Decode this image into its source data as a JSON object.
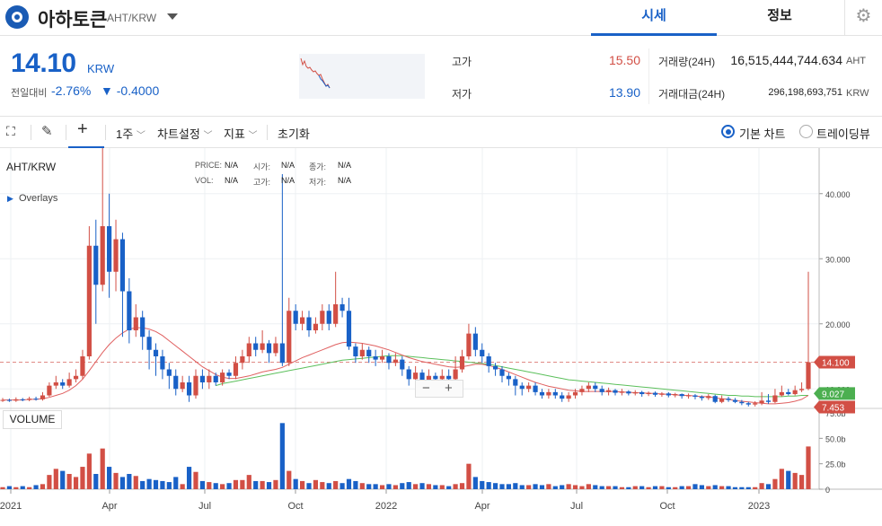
{
  "header": {
    "coin_name": "아하토큰",
    "pair": "AHT/KRW",
    "tab_quote": "시세",
    "tab_info": "정보"
  },
  "price": {
    "current": "14.10",
    "unit": "KRW",
    "change_label": "전일대비",
    "change_rate": "-2.76%",
    "change_amount": "▼ -0.4000"
  },
  "stats": {
    "high_label": "고가",
    "high_value": "15.50",
    "low_label": "저가",
    "low_value": "13.90",
    "volume_label": "거래량(24H)",
    "volume_value": "16,515,444,744.634",
    "volume_unit": "AHT",
    "amount_label": "거래대금(24H)",
    "amount_value": "296,198,693,751",
    "amount_unit": "KRW"
  },
  "toolbar": {
    "interval": "1주",
    "chart_settings": "차트설정",
    "indicators": "지표",
    "reset": "초기화",
    "basic_chart": "기본 차트",
    "trading_view": "트레이딩뷰"
  },
  "colors": {
    "up": "#d24f45",
    "down": "#1961c7",
    "ma_short": "#e06060",
    "ma_long": "#5cc05c",
    "accent": "#1961c7"
  },
  "chart_data": {
    "type": "candlestick",
    "title": "AHT/KRW",
    "overlays_label": "Overlays",
    "info": {
      "price_label": "PRICE:",
      "price": "N/A",
      "time_label": "시가:",
      "time": "N/A",
      "close_label": "종가:",
      "close": "N/A",
      "vol_label": "VOL:",
      "vol": "N/A",
      "high_label": "고가:",
      "high": "N/A",
      "low_label": "저가:",
      "low": "N/A"
    },
    "x_ticks": [
      "2021",
      "Apr",
      "Jul",
      "Oct",
      "2022",
      "Apr",
      "Jul",
      "Oct",
      "2023"
    ],
    "y_ticks": [
      "40.000",
      "30.000",
      "20.000",
      "10.000"
    ],
    "ylim": [
      7,
      47
    ],
    "volume_label": "VOLUME",
    "volume_ticks": [
      "75.0b",
      "50.0b",
      "25.0b",
      "0"
    ],
    "volume_ylim": [
      0,
      75
    ],
    "price_tags": {
      "current": "14.100",
      "ma_long": "9.027",
      "ma_short": "7.453"
    },
    "candles": [
      [
        8.2,
        8.3,
        8.6,
        8.0,
        2
      ],
      [
        8.3,
        8.2,
        8.5,
        8.0,
        3
      ],
      [
        8.2,
        8.4,
        8.7,
        8.0,
        2
      ],
      [
        8.4,
        8.3,
        8.6,
        8.1,
        3
      ],
      [
        8.3,
        8.5,
        8.8,
        8.1,
        2
      ],
      [
        8.5,
        8.4,
        8.8,
        8.2,
        4
      ],
      [
        8.4,
        9.0,
        9.5,
        8.2,
        5
      ],
      [
        9.0,
        10.5,
        11.0,
        8.8,
        14
      ],
      [
        10.5,
        11.0,
        12.0,
        10.0,
        20
      ],
      [
        11.0,
        10.5,
        11.5,
        10.0,
        18
      ],
      [
        10.5,
        11.5,
        12.5,
        10.2,
        15
      ],
      [
        11.5,
        12.0,
        13.0,
        11.0,
        12
      ],
      [
        12.0,
        15.0,
        16.0,
        11.5,
        22
      ],
      [
        15.0,
        32.0,
        35.0,
        14.5,
        35
      ],
      [
        32.0,
        26.0,
        36.0,
        20.0,
        15
      ],
      [
        26.0,
        35.0,
        47.0,
        25.0,
        40
      ],
      [
        35.0,
        28.0,
        40.0,
        24.0,
        22
      ],
      [
        28.0,
        33.0,
        36.0,
        25.0,
        16
      ],
      [
        33.0,
        25.0,
        34.0,
        18.0,
        12
      ],
      [
        25.0,
        19.0,
        27.0,
        17.0,
        15
      ],
      [
        19.0,
        21.0,
        23.0,
        18.0,
        13
      ],
      [
        21.0,
        18.0,
        22.0,
        16.0,
        8
      ],
      [
        18.0,
        16.0,
        19.0,
        13.0,
        10
      ],
      [
        16.0,
        15.0,
        17.0,
        12.0,
        9
      ],
      [
        15.0,
        13.0,
        16.0,
        11.5,
        8
      ],
      [
        13.0,
        12.0,
        14.0,
        10.0,
        7
      ],
      [
        12.0,
        10.0,
        13.0,
        9.0,
        12
      ],
      [
        10.0,
        11.0,
        12.0,
        9.5,
        5
      ],
      [
        11.0,
        9.0,
        12.0,
        8.0,
        22
      ],
      [
        9.0,
        12.0,
        13.0,
        8.5,
        17
      ],
      [
        12.0,
        11.0,
        13.0,
        10.0,
        8
      ],
      [
        11.0,
        12.0,
        13.0,
        10.0,
        7
      ],
      [
        12.0,
        11.0,
        12.5,
        10.5,
        6
      ],
      [
        11.0,
        12.5,
        13.0,
        10.5,
        5
      ],
      [
        12.5,
        12.0,
        13.0,
        11.5,
        6
      ],
      [
        12.0,
        14.0,
        15.0,
        11.5,
        9
      ],
      [
        14.0,
        15.0,
        16.0,
        13.0,
        9
      ],
      [
        15.0,
        17.0,
        18.0,
        14.0,
        14
      ],
      [
        17.0,
        16.0,
        18.0,
        15.0,
        8
      ],
      [
        16.0,
        17.0,
        19.0,
        15.5,
        8
      ],
      [
        17.0,
        15.5,
        17.5,
        14.0,
        7
      ],
      [
        15.5,
        17.0,
        18.0,
        15.0,
        9
      ],
      [
        17.0,
        14.0,
        43.0,
        13.5,
        65
      ],
      [
        14.0,
        22.0,
        24.0,
        13.5,
        18
      ],
      [
        22.0,
        20.0,
        23.0,
        19.0,
        10
      ],
      [
        20.0,
        21.0,
        22.0,
        19.0,
        8
      ],
      [
        21.0,
        19.0,
        22.0,
        18.0,
        6
      ],
      [
        19.0,
        20.0,
        21.0,
        18.5,
        9
      ],
      [
        20.0,
        22.0,
        23.0,
        19.0,
        7
      ],
      [
        22.0,
        20.0,
        23.0,
        19.0,
        6
      ],
      [
        20.0,
        23.0,
        28.0,
        19.5,
        8
      ],
      [
        23.0,
        22.0,
        24.0,
        21.0,
        6
      ],
      [
        22.0,
        16.5,
        24.0,
        16.0,
        10
      ],
      [
        16.5,
        15.0,
        17.0,
        14.0,
        8
      ],
      [
        15.0,
        16.0,
        17.0,
        14.5,
        6
      ],
      [
        16.0,
        15.0,
        16.5,
        14.0,
        5
      ],
      [
        15.0,
        14.5,
        16.0,
        13.5,
        5
      ],
      [
        14.5,
        15.0,
        16.0,
        14.0,
        4
      ],
      [
        15.0,
        14.0,
        15.5,
        13.0,
        5
      ],
      [
        14.0,
        14.5,
        15.5,
        13.5,
        4
      ],
      [
        14.5,
        13.0,
        15.0,
        12.0,
        6
      ],
      [
        13.0,
        11.5,
        13.5,
        10.5,
        7
      ],
      [
        11.5,
        12.5,
        13.5,
        11.0,
        5
      ],
      [
        12.5,
        11.0,
        13.0,
        10.0,
        6
      ],
      [
        11.0,
        12.0,
        13.0,
        10.5,
        5
      ],
      [
        12.0,
        11.5,
        12.5,
        11.0,
        4
      ],
      [
        11.5,
        12.0,
        13.0,
        11.0,
        4
      ],
      [
        12.0,
        11.5,
        13.0,
        11.0,
        3
      ],
      [
        11.5,
        13.0,
        15.0,
        11.0,
        5
      ],
      [
        13.0,
        15.0,
        16.0,
        12.5,
        6
      ],
      [
        15.0,
        18.5,
        20.0,
        14.5,
        25
      ],
      [
        18.5,
        16.0,
        19.5,
        15.0,
        12
      ],
      [
        16.0,
        15.0,
        17.0,
        14.0,
        8
      ],
      [
        15.0,
        13.5,
        15.5,
        12.5,
        7
      ],
      [
        13.5,
        13.0,
        14.0,
        12.0,
        6
      ],
      [
        13.0,
        12.0,
        13.5,
        11.0,
        5
      ],
      [
        12.0,
        11.5,
        12.5,
        10.5,
        5
      ],
      [
        11.5,
        10.5,
        12.0,
        9.0,
        6
      ],
      [
        10.5,
        10.0,
        11.0,
        9.0,
        4
      ],
      [
        10.0,
        10.5,
        11.0,
        9.5,
        4
      ],
      [
        10.5,
        9.5,
        11.0,
        9.0,
        5
      ],
      [
        9.5,
        9.0,
        10.0,
        8.5,
        4
      ],
      [
        9.0,
        9.5,
        10.0,
        8.5,
        5
      ],
      [
        9.5,
        9.0,
        10.0,
        8.5,
        3
      ],
      [
        9.0,
        8.5,
        9.5,
        8.0,
        4
      ],
      [
        8.5,
        9.0,
        9.5,
        8.0,
        5
      ],
      [
        9.0,
        9.5,
        10.0,
        8.5,
        4
      ],
      [
        9.5,
        10.0,
        10.5,
        9.0,
        3
      ],
      [
        10.0,
        10.5,
        11.0,
        9.5,
        5
      ],
      [
        10.5,
        10.0,
        11.0,
        9.5,
        4
      ],
      [
        10.0,
        9.5,
        10.5,
        9.0,
        3
      ],
      [
        9.5,
        9.8,
        10.2,
        9.0,
        3
      ],
      [
        9.8,
        9.4,
        10.0,
        9.0,
        3
      ],
      [
        9.4,
        9.6,
        10.0,
        9.0,
        2
      ],
      [
        9.6,
        9.3,
        9.8,
        9.0,
        2
      ],
      [
        9.3,
        9.5,
        9.8,
        9.0,
        3
      ],
      [
        9.5,
        9.2,
        9.7,
        8.8,
        3
      ],
      [
        9.2,
        9.4,
        9.6,
        8.9,
        2
      ],
      [
        9.4,
        9.1,
        9.6,
        8.8,
        3
      ],
      [
        9.1,
        9.3,
        9.5,
        8.8,
        3
      ],
      [
        9.3,
        9.0,
        9.5,
        8.7,
        2
      ],
      [
        9.0,
        9.2,
        9.4,
        8.7,
        2
      ],
      [
        9.2,
        8.9,
        9.3,
        8.5,
        3
      ],
      [
        8.9,
        9.0,
        9.3,
        8.5,
        3
      ],
      [
        9.0,
        8.8,
        9.2,
        8.4,
        5
      ],
      [
        8.8,
        8.6,
        9.0,
        8.2,
        4
      ],
      [
        8.6,
        8.9,
        9.2,
        8.3,
        3
      ],
      [
        8.9,
        8.0,
        9.1,
        7.8,
        4
      ],
      [
        8.0,
        8.5,
        9.0,
        7.8,
        3
      ],
      [
        8.5,
        8.3,
        8.8,
        8.0,
        3
      ],
      [
        8.3,
        8.0,
        8.6,
        7.8,
        2
      ],
      [
        8.0,
        7.8,
        8.3,
        7.5,
        2
      ],
      [
        7.8,
        7.6,
        8.0,
        7.3,
        2
      ],
      [
        7.6,
        7.8,
        8.1,
        7.3,
        2
      ],
      [
        7.8,
        8.2,
        9.5,
        7.5,
        6
      ],
      [
        8.2,
        8.0,
        9.2,
        7.7,
        5
      ],
      [
        8.0,
        9.0,
        10.0,
        7.8,
        10
      ],
      [
        9.0,
        9.5,
        10.5,
        8.8,
        20
      ],
      [
        9.5,
        9.2,
        10.0,
        9.0,
        18
      ],
      [
        9.2,
        9.8,
        10.5,
        9.0,
        16
      ],
      [
        9.8,
        10.0,
        11.0,
        9.5,
        14
      ],
      [
        10.0,
        14.1,
        28.0,
        9.8,
        42
      ]
    ],
    "ma_short": [
      8.3,
      8.3,
      8.3,
      8.3,
      8.4,
      8.4,
      8.5,
      8.7,
      9.0,
      9.3,
      9.8,
      10.5,
      11.5,
      12.8,
      14.2,
      15.6,
      16.8,
      17.8,
      18.6,
      19.2,
      19.4,
      19.4,
      19.2,
      18.8,
      18.2,
      17.4,
      16.6,
      15.8,
      15.0,
      14.2,
      13.4,
      12.8,
      12.2,
      11.8,
      11.6,
      11.6,
      11.8,
      12.0,
      12.3,
      12.6,
      12.8,
      13.0,
      13.3,
      13.8,
      14.3,
      14.8,
      15.2,
      15.6,
      16.0,
      16.4,
      16.8,
      17.1,
      17.2,
      17.1,
      17.0,
      16.8,
      16.6,
      16.3,
      16.0,
      15.6,
      15.2,
      14.8,
      14.5,
      14.2,
      14.0,
      13.8,
      13.6,
      13.4,
      13.3,
      13.4,
      13.6,
      13.8,
      13.8,
      13.6,
      13.3,
      13.0,
      12.6,
      12.2,
      11.8,
      11.4,
      11.0,
      10.7,
      10.4,
      10.2,
      10.0,
      9.8,
      9.7,
      9.6,
      9.6,
      9.6,
      9.6,
      9.6,
      9.6,
      9.5,
      9.5,
      9.4,
      9.4,
      9.3,
      9.3,
      9.2,
      9.2,
      9.1,
      9.0,
      9.0,
      8.9,
      8.8,
      8.8,
      8.6,
      8.5,
      8.4,
      8.2,
      8.1,
      8.0,
      7.9,
      7.8,
      7.7,
      7.7,
      7.8,
      7.9,
      8.1,
      8.4,
      9.0
    ],
    "ma_long": [
      null,
      null,
      null,
      null,
      null,
      null,
      null,
      null,
      null,
      null,
      null,
      null,
      null,
      null,
      null,
      null,
      null,
      null,
      null,
      null,
      null,
      null,
      null,
      null,
      null,
      null,
      null,
      null,
      null,
      null,
      null,
      null,
      10.5,
      10.8,
      11.0,
      11.2,
      11.4,
      11.6,
      11.8,
      12.0,
      12.2,
      12.4,
      12.6,
      12.8,
      13.0,
      13.2,
      13.4,
      13.6,
      13.8,
      14.0,
      14.2,
      14.4,
      14.5,
      14.6,
      14.7,
      14.8,
      14.9,
      15.0,
      15.1,
      15.1,
      15.1,
      15.0,
      14.9,
      14.8,
      14.7,
      14.6,
      14.5,
      14.4,
      14.3,
      14.2,
      14.1,
      14.0,
      13.9,
      13.8,
      13.6,
      13.4,
      13.2,
      13.0,
      12.8,
      12.6,
      12.4,
      12.2,
      12.0,
      11.8,
      11.6,
      11.4,
      11.3,
      11.2,
      11.1,
      11.0,
      10.9,
      10.8,
      10.7,
      10.6,
      10.5,
      10.4,
      10.3,
      10.2,
      10.1,
      10.0,
      9.9,
      9.8,
      9.7,
      9.6,
      9.5,
      9.4,
      9.3,
      9.2,
      9.1,
      9.0,
      9.0,
      8.9,
      8.9,
      8.8,
      8.8,
      8.8,
      8.8,
      8.8,
      8.9,
      8.9,
      9.0,
      9.0
    ]
  }
}
